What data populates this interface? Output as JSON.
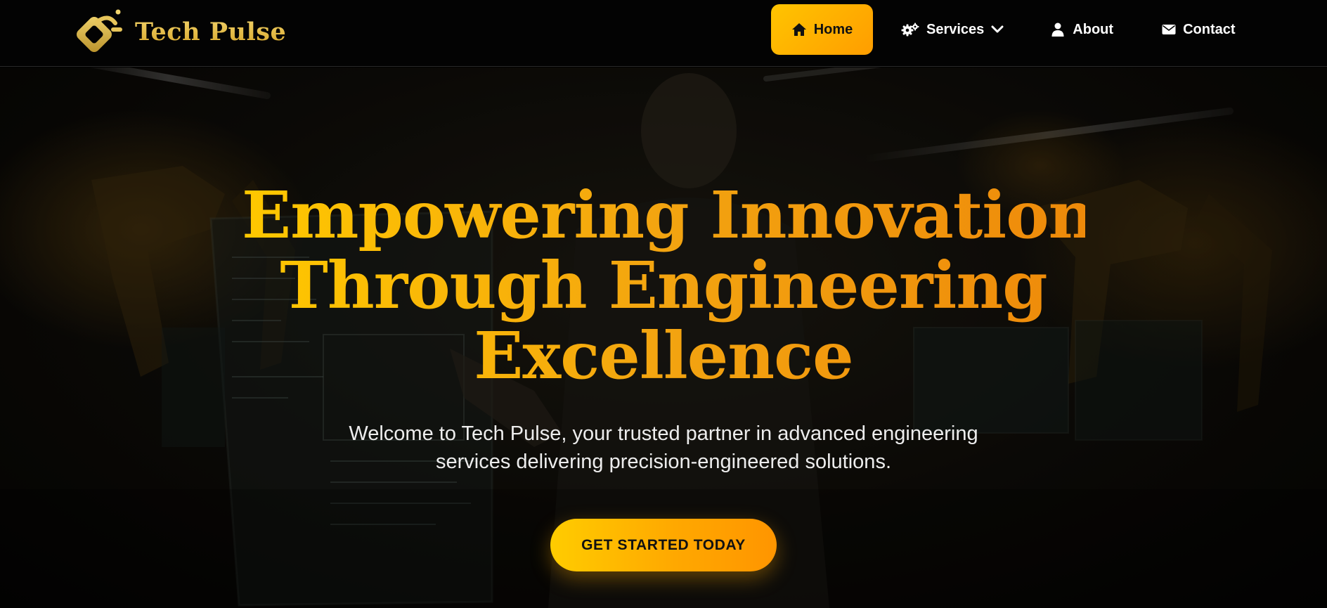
{
  "brand": {
    "name": "Tech Pulse",
    "logo_icon": "tech-pulse-logo-icon",
    "color": "#d9ac2f"
  },
  "nav": {
    "items": [
      {
        "label": "Home",
        "icon": "home-icon",
        "active": true
      },
      {
        "label": "Services",
        "icon": "gears-icon",
        "has_dropdown": true
      },
      {
        "label": "About",
        "icon": "user-icon"
      },
      {
        "label": "Contact",
        "icon": "envelope-icon"
      }
    ],
    "active_color": "#ffb300"
  },
  "hero": {
    "title_lines": [
      "Empowering Innovation",
      "Through Engineering",
      "Excellence"
    ],
    "subtitle_lines": [
      "Welcome to Tech Pulse, your trusted partner in advanced engineering",
      "services delivering precision-engineered solutions."
    ],
    "cta_label": "GET STARTED TODAY",
    "accent_color": "#f3a410"
  }
}
